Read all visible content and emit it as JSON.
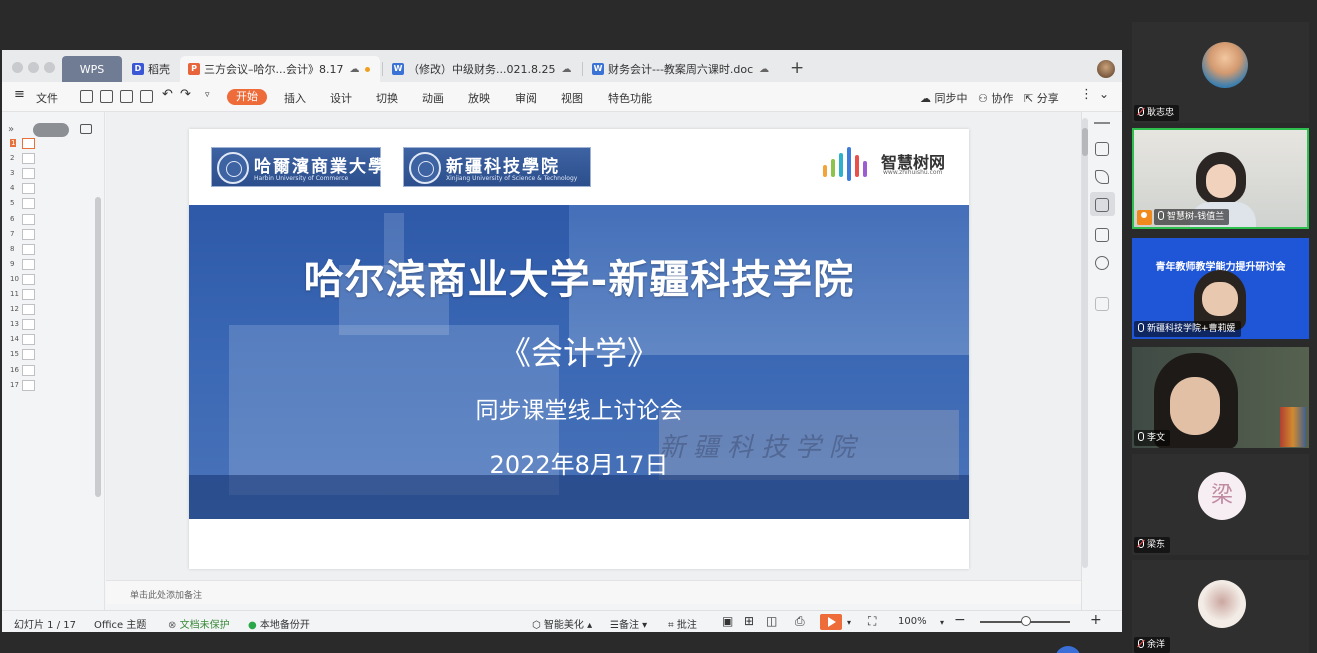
{
  "tabs": {
    "wps": "WPS",
    "daoke": "稻壳",
    "tab1": "三方会议–哈尔...会计》8.17",
    "tab2": "（修改）中级财务...021.8.25",
    "tab3": "财务会计---教案周六课时.doc"
  },
  "toolbar": {
    "file": "文件",
    "start": "开始",
    "menu": [
      "插入",
      "设计",
      "切换",
      "动画",
      "放映",
      "审阅",
      "视图",
      "特色功能"
    ],
    "sync": "同步中",
    "collab": "协作",
    "share": "分享"
  },
  "thumbnails": {
    "count_items": [
      "1",
      "2",
      "3",
      "4",
      "5",
      "6",
      "7",
      "8",
      "9",
      "10",
      "11",
      "12",
      "13",
      "14",
      "15",
      "16",
      "17"
    ]
  },
  "slide": {
    "logo1_cn": "哈爾濱商業大學",
    "logo1_en": "Harbin University of Commerce",
    "logo2_cn": "新疆科技學院",
    "logo2_en": "Xinjiang University of Science & Technology",
    "brand_name": "智慧树网",
    "brand_url": "www.zhihuishu.com",
    "wall_text": "新疆科技学院",
    "title": "哈尔滨商业大学-新疆科技学院",
    "course": "《会计学》",
    "meeting": "同步课堂线上讨论会",
    "date": "2022年8月17日"
  },
  "notes_placeholder": "单击此处添加备注",
  "status": {
    "slide_counter": "幻灯片 1 / 17",
    "theme": "Office 主题",
    "protect": "文档未保护",
    "backup": "本地备份开",
    "beautify": "智能美化",
    "notes": "备注",
    "comment": "批注",
    "zoom": "100%"
  },
  "participants": [
    {
      "name": "耿志忠"
    },
    {
      "name": "智慧树-钱值兰"
    },
    {
      "name": "新疆科技学院+曹莉媛",
      "banner": "青年教师教学能力提升研讨会"
    },
    {
      "name": "李文"
    },
    {
      "name": "梁东",
      "avatar_char": "梁"
    },
    {
      "name": "余洋"
    }
  ],
  "colors": {
    "accent": "#ee6b3a",
    "speaking": "#2fbf4f",
    "slide_blue": "#2d59a8"
  }
}
